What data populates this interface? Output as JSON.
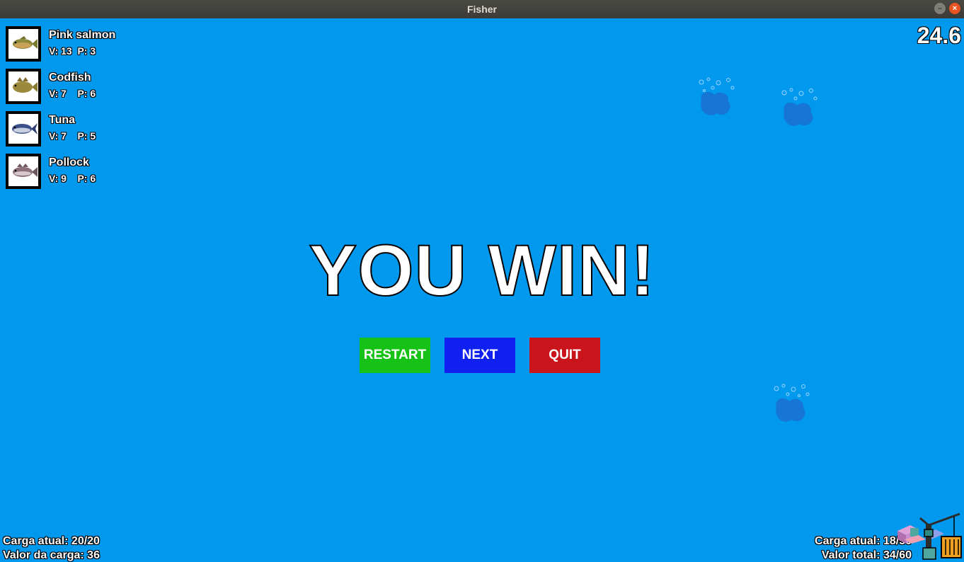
{
  "window": {
    "title": "Fisher"
  },
  "fish": [
    {
      "name": "Pink salmon",
      "stats": "V: 13  P: 3",
      "icon": "pink-salmon-icon"
    },
    {
      "name": "Codfish",
      "stats": "V: 7    P: 6",
      "icon": "codfish-icon"
    },
    {
      "name": "Tuna",
      "stats": "V: 7    P: 5",
      "icon": "tuna-icon"
    },
    {
      "name": "Pollock",
      "stats": "V: 9    P: 6",
      "icon": "pollock-icon"
    }
  ],
  "timer": "24.6",
  "result": {
    "title": "YOU WIN!"
  },
  "buttons": {
    "restart": "RESTART",
    "next": "NEXT",
    "quit": "QUIT"
  },
  "colors": {
    "water": "#0099ee",
    "restart": "#17c217",
    "next": "#1020f0",
    "quit": "#c8141a"
  },
  "hud_left": {
    "carga_atual": "Carga atual: 20/20",
    "valor_carga": "Valor da carga: 36"
  },
  "hud_right": {
    "carga_atual": "Carga atual: 18/50",
    "valor_total": "Valor total: 34/60"
  }
}
